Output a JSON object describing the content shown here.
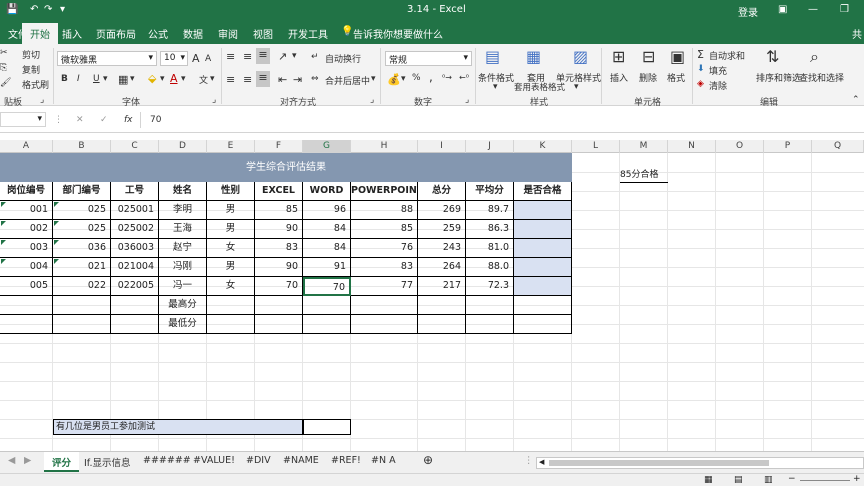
{
  "app": {
    "doc_title": "3.14  -  Excel",
    "login": "登录",
    "share": "共"
  },
  "tabs": [
    "文件",
    "开始",
    "插入",
    "页面布局",
    "公式",
    "数据",
    "审阅",
    "视图",
    "开发工具"
  ],
  "tell_me": "告诉我你想要做什么",
  "ribbon": {
    "clipboard": {
      "cut": "剪切",
      "copy": "复制",
      "format_painter": "格式刷",
      "label": "贴板"
    },
    "font": {
      "name": "微软雅黑",
      "size": "10",
      "bold": "B",
      "italic": "I",
      "underline": "U",
      "label": "字体",
      "grow": "A",
      "shrink": "A",
      "color_a": "A",
      "wen": "文"
    },
    "alignment": {
      "wrap": "自动换行",
      "merge": "合并后居中",
      "label": "对齐方式"
    },
    "number": {
      "format": "常规",
      "label": "数字",
      "percent": "%",
      "comma": ","
    },
    "styles": {
      "conditional": "条件格式",
      "table": "套用表格格式",
      "cell": "单元格样式",
      "label": "样式"
    },
    "cells": {
      "insert": "插入",
      "delete": "删除",
      "format": "格式",
      "label": "单元格"
    },
    "editing": {
      "autosum": "自动求和",
      "fill": "填充",
      "clear": "清除",
      "sort": "排序和筛选",
      "find": "查找和选择",
      "label": "编辑"
    }
  },
  "formula_bar": {
    "value": "70",
    "fx": "fx"
  },
  "columns": [
    "A",
    "B",
    "C",
    "D",
    "E",
    "F",
    "G",
    "H",
    "I",
    "J",
    "K",
    "L",
    "M",
    "N",
    "O",
    "P",
    "Q"
  ],
  "table": {
    "title": "学生综合评估结果",
    "headers": [
      "岗位编号",
      "部门编号",
      "工号",
      "姓名",
      "性别",
      "EXCEL",
      "WORD",
      "POWERPOINT",
      "总分",
      "平均分",
      "是否合格"
    ],
    "rows": [
      [
        "001",
        "025",
        "025001",
        "李明",
        "男",
        "85",
        "96",
        "88",
        "269",
        "89.7",
        ""
      ],
      [
        "002",
        "025",
        "025002",
        "王海",
        "男",
        "90",
        "84",
        "85",
        "259",
        "86.3",
        ""
      ],
      [
        "003",
        "036",
        "036003",
        "赵宁",
        "女",
        "83",
        "84",
        "76",
        "243",
        "81.0",
        ""
      ],
      [
        "004",
        "021",
        "021004",
        "冯刚",
        "男",
        "90",
        "91",
        "83",
        "264",
        "88.0",
        ""
      ],
      [
        "005",
        "022",
        "022005",
        "冯一",
        "女",
        "70",
        "70",
        "77",
        "217",
        "72.3",
        ""
      ]
    ],
    "max_label": "最高分",
    "min_label": "最低分"
  },
  "note": "85分合格",
  "question": "有几位是男员工参加测试",
  "sheets": [
    "评分",
    "If.显示信息",
    "######",
    "#VALUE!",
    "#DIV",
    "#NAME",
    "#REF!",
    "#N A"
  ],
  "colors": {
    "excel_green": "#217346",
    "table_header": "#8497b0",
    "pass_fill": "#d9e1f2"
  }
}
